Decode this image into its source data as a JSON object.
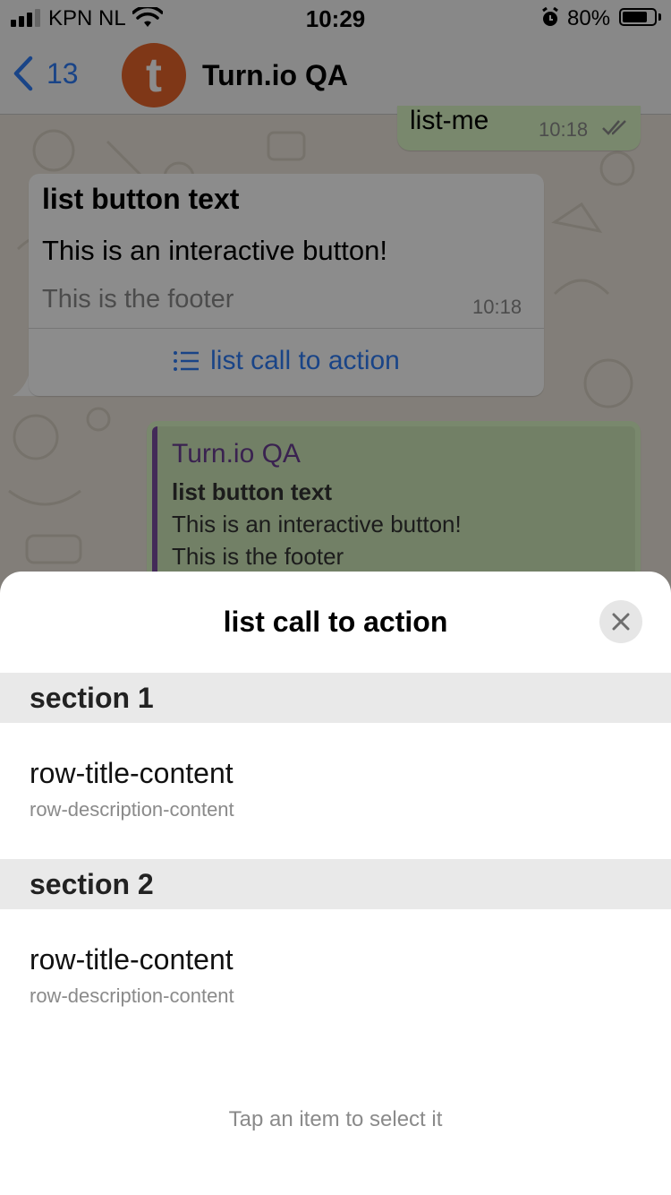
{
  "status_bar": {
    "carrier": "KPN NL",
    "time": "10:29",
    "battery": "80%"
  },
  "nav": {
    "back_count": "13",
    "avatar_letter": "t",
    "contact_name": "Turn.io QA",
    "avatar_color": "#e8642a"
  },
  "messages": {
    "outgoing_top": {
      "text": "list-me",
      "time": "10:18"
    },
    "incoming": {
      "header": "list button text",
      "body": "This is an interactive button!",
      "footer": "This is the footer",
      "time": "10:18",
      "cta": "list call to action"
    },
    "outgoing_quote": {
      "author": "Turn.io QA",
      "title": "list button text",
      "body": "This is an interactive button!",
      "footer": "This is the footer"
    }
  },
  "sheet": {
    "title": "list call to action",
    "sections": [
      {
        "title": "section 1",
        "rows": [
          {
            "title": "row-title-content",
            "description": "row-description-content"
          }
        ]
      },
      {
        "title": "section 2",
        "rows": [
          {
            "title": "row-title-content",
            "description": "row-description-content"
          }
        ]
      }
    ],
    "hint": "Tap an item to select it"
  },
  "colors": {
    "accent": "#2f7cf6",
    "outgoing_bubble": "#dcf8c6",
    "quote_bar": "#7a4ea0"
  }
}
